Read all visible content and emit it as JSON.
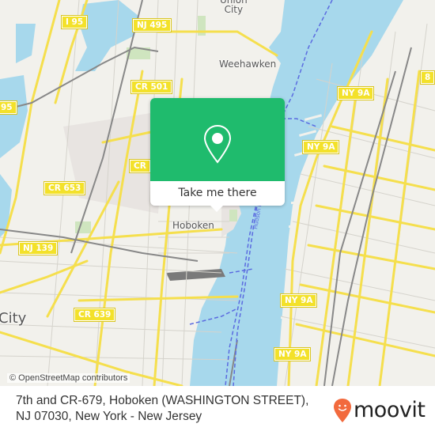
{
  "map": {
    "colors": {
      "land": "#f2f1ec",
      "water": "#a7d8ec",
      "major_road": "#f5df4d",
      "minor_road": "#d5d3cc",
      "rail": "#888888",
      "ferry": "#5b6be0",
      "park": "#cfe5bf",
      "urban": "#e6e2de"
    },
    "places": [
      {
        "id": "union-city",
        "label": "Union\nCity"
      },
      {
        "id": "weehawken",
        "label": "Weehawken"
      },
      {
        "id": "hoboken",
        "label": "Hoboken"
      },
      {
        "id": "jersey-city",
        "label": "City"
      }
    ],
    "shields": [
      {
        "id": "i95-top",
        "label": "I 95"
      },
      {
        "id": "nj495",
        "label": "NJ 495"
      },
      {
        "id": "cr501",
        "label": "CR 501"
      },
      {
        "id": "i95-left",
        "label": "95"
      },
      {
        "id": "cr-partial",
        "label": "CR"
      },
      {
        "id": "cr653",
        "label": "CR 653"
      },
      {
        "id": "nj139",
        "label": "NJ 139"
      },
      {
        "id": "cr639",
        "label": "CR 639"
      },
      {
        "id": "ny9a-1",
        "label": "NY 9A"
      },
      {
        "id": "ny9a-2",
        "label": "NY 9A"
      },
      {
        "id": "ny9a-3",
        "label": "NY 9A"
      },
      {
        "id": "ny9a-4",
        "label": "NY 9A"
      },
      {
        "id": "route-8",
        "label": "8"
      }
    ],
    "river_label": "Hudson River"
  },
  "popup": {
    "icon": "map-pin-icon",
    "button_label": "Take me there",
    "accent": "#1fbb6d"
  },
  "attribution": "© OpenStreetMap contributors",
  "footer": {
    "address": "7th and CR-679, Hoboken (WASHINGTON STREET), NJ 07030, New York - New Jersey",
    "logo": {
      "text": "moovit",
      "icon": "moovit-smiley-pin-icon",
      "icon_color": "#f26a3d"
    }
  }
}
